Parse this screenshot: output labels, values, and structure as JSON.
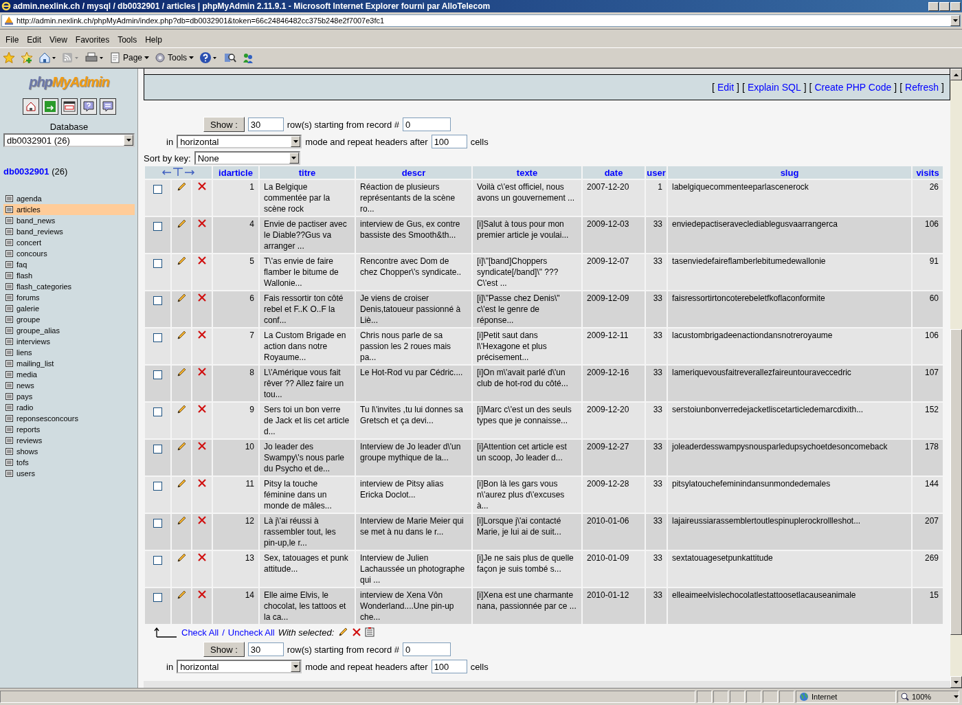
{
  "window": {
    "title": "admin.nexlink.ch / mysql / db0032901 / articles | phpMyAdmin 2.11.9.1 - Microsoft Internet Explorer fourni par AlloTelecom",
    "address": "http://admin.nexlink.ch/phpMyAdmin/index.php?db=db0032901&token=66c24846482cc375b248e2f7007e3fc1"
  },
  "menu": [
    "File",
    "Edit",
    "View",
    "Favorites",
    "Tools",
    "Help"
  ],
  "toolbar": {
    "page": "Page",
    "tools": "Tools"
  },
  "sidebar": {
    "logo_php": "php",
    "logo_admin": "MyAdmin",
    "database_label": "Database",
    "database_select": "db0032901 (26)",
    "db_name": "db0032901",
    "db_count": "(26)",
    "tables": [
      {
        "name": "agenda",
        "selected": false
      },
      {
        "name": "articles",
        "selected": true
      },
      {
        "name": "band_news",
        "selected": false
      },
      {
        "name": "band_reviews",
        "selected": false
      },
      {
        "name": "concert",
        "selected": false
      },
      {
        "name": "concours",
        "selected": false
      },
      {
        "name": "faq",
        "selected": false
      },
      {
        "name": "flash",
        "selected": false
      },
      {
        "name": "flash_categories",
        "selected": false
      },
      {
        "name": "forums",
        "selected": false
      },
      {
        "name": "galerie",
        "selected": false
      },
      {
        "name": "groupe",
        "selected": false
      },
      {
        "name": "groupe_alias",
        "selected": false
      },
      {
        "name": "interviews",
        "selected": false
      },
      {
        "name": "liens",
        "selected": false
      },
      {
        "name": "mailing_list",
        "selected": false
      },
      {
        "name": "media",
        "selected": false
      },
      {
        "name": "news",
        "selected": false
      },
      {
        "name": "pays",
        "selected": false
      },
      {
        "name": "radio",
        "selected": false
      },
      {
        "name": "reponsesconcours",
        "selected": false
      },
      {
        "name": "reports",
        "selected": false
      },
      {
        "name": "reviews",
        "selected": false
      },
      {
        "name": "shows",
        "selected": false
      },
      {
        "name": "tofs",
        "selected": false
      },
      {
        "name": "users",
        "selected": false
      }
    ]
  },
  "query_links": {
    "open": "[",
    "close": "]",
    "links": [
      "Edit",
      "Explain SQL",
      "Create PHP Code",
      "Refresh"
    ]
  },
  "nav_top": {
    "show_button": "Show :",
    "rows": "30",
    "starting_text": "row(s) starting from record #",
    "start": "0",
    "in_label": "in",
    "mode": "horizontal",
    "repeat_text": "mode and repeat headers after",
    "repeat": "100",
    "cells_label": "cells"
  },
  "sort": {
    "label": "Sort by key:",
    "value": "None"
  },
  "table": {
    "columns": [
      "idarticle",
      "titre",
      "descr",
      "texte",
      "date",
      "user",
      "slug",
      "visits"
    ],
    "rows": [
      {
        "checked": false,
        "cells": [
          "1",
          "La Belgique commentée par la scène rock",
          "Réaction de plusieurs représentants de la scène ro...",
          "Voilà c\\'est officiel, nous avons un gouvernement ...",
          "2007-12-20",
          "1",
          "labelgiquecommenteeparlascenerock",
          "26"
        ]
      },
      {
        "checked": false,
        "cells": [
          "4",
          "Envie de pactiser avec le Diable??Gus va arranger ...",
          "interview de Gus, ex contre bassiste des Smooth&th...",
          "[i]Salut à tous pour mon premier article je voulai...",
          "2009-12-03",
          "33",
          "enviedepactiseraveclediablegusvaarrangerca",
          "106"
        ]
      },
      {
        "checked": false,
        "cells": [
          "5",
          "T\\'as envie de faire flamber le bitume de Wallonie...",
          "Rencontre avec Dom de chez Chopper\\'s syndicate..",
          "[i]\\\"[band]Choppers syndicate[/band]\\\" ??? C\\'est ...",
          "2009-12-07",
          "33",
          "tasenviedefaireflamberlebitumedewallonie",
          "91"
        ]
      },
      {
        "checked": false,
        "cells": [
          "6",
          "Fais ressortir ton côté rebel et F..K O..F la conf...",
          "Je viens de croiser Denis,tatoueur passionné à Liè...",
          "[i]\\\"Passe chez Denis\\\" c\\'est le genre de réponse...",
          "2009-12-09",
          "33",
          "faisressortirtoncoterebeletfkoflaconformite",
          "60"
        ]
      },
      {
        "checked": false,
        "cells": [
          "7",
          "La Custom Brigade en action dans notre Royaume...",
          "Chris nous parle de sa passion les 2 roues mais pa...",
          "[i]Petit saut dans l\\'Hexagone et plus précisement...",
          "2009-12-11",
          "33",
          "lacustombrigadeenactiondansnotreroyaume",
          "106"
        ]
      },
      {
        "checked": false,
        "cells": [
          "8",
          "L\\'Amérique vous fait rêver ?? Allez faire un tou...",
          "Le Hot-Rod vu par Cédric....",
          "[i]On m\\'avait parlé d\\'un club de hot-rod du côté...",
          "2009-12-16",
          "33",
          "lameriquevousfaitreverallezfaireuntouraveccedric",
          "107"
        ]
      },
      {
        "checked": false,
        "cells": [
          "9",
          "Sers toi un bon verre de Jack et lis cet article d...",
          "Tu l\\'invites ,tu lui donnes sa Gretsch et ça devi...",
          "[i]Marc c\\'est un des seuls types que je connaisse...",
          "2009-12-20",
          "33",
          "serstoiunbonverredejacketliscetarticledemarcdixith...",
          "152"
        ]
      },
      {
        "checked": false,
        "cells": [
          "10",
          "Jo leader des Swampy\\'s nous parle du Psycho et de...",
          "Interview de Jo leader d\\'un groupe mythique de la...",
          "[i]Attention cet article est un scoop, Jo leader d...",
          "2009-12-27",
          "33",
          "joleaderdesswampysnousparledupsychoetdesoncomeback",
          "178"
        ]
      },
      {
        "checked": false,
        "cells": [
          "11",
          "Pitsy la touche féminine dans un monde de mâles...",
          "interview de Pitsy alias Ericka Doclot...",
          "[i]Bon là les gars vous n\\'aurez plus d\\'excuses à...",
          "2009-12-28",
          "33",
          "pitsylatouchefeminindansunmondedemales",
          "144"
        ]
      },
      {
        "checked": false,
        "cells": [
          "12",
          "Là j\\'ai réussi à rassembler tout, les pin-up,le r...",
          "Interview de Marie Meier qui se met à nu dans le r...",
          "[i]Lorsque j\\'ai contacté Marie, je lui ai de suit...",
          "2010-01-06",
          "33",
          "lajaireussiarassemblertoutlespinuplerockrollleshot...",
          "207"
        ]
      },
      {
        "checked": false,
        "cells": [
          "13",
          "Sex, tatouages et punk attitude...",
          "Interview de Julien Lachaussée un photographe qui ...",
          "[i]Je ne sais plus de quelle façon je suis tombé s...",
          "2010-01-09",
          "33",
          "sextatouagesetpunkattitude",
          "269"
        ]
      },
      {
        "checked": false,
        "cells": [
          "14",
          "Elle aime Elvis, le chocolat, les tattoos et la ca...",
          "interview de Xena Vôn Wonderland....Une pin-up che...",
          "[i]Xena est une charmante nana, passionnée par ce ...",
          "2010-01-12",
          "33",
          "elleaimeelvislechocolatlestattoosetlacauseanimale",
          "15"
        ]
      }
    ]
  },
  "footer": {
    "check_all": "Check All",
    "separator": "/",
    "uncheck_all": "Uncheck All",
    "with_selected": "With selected:"
  },
  "nav_bottom": {
    "show_button": "Show :",
    "rows": "30",
    "starting_text": "row(s) starting from record #",
    "start": "0",
    "in_label": "in",
    "mode": "horizontal",
    "repeat_text": "mode and repeat headers after",
    "repeat": "100",
    "cells_label": "cells"
  },
  "status_bar": {
    "zone": "Internet",
    "zoom": "100%"
  }
}
